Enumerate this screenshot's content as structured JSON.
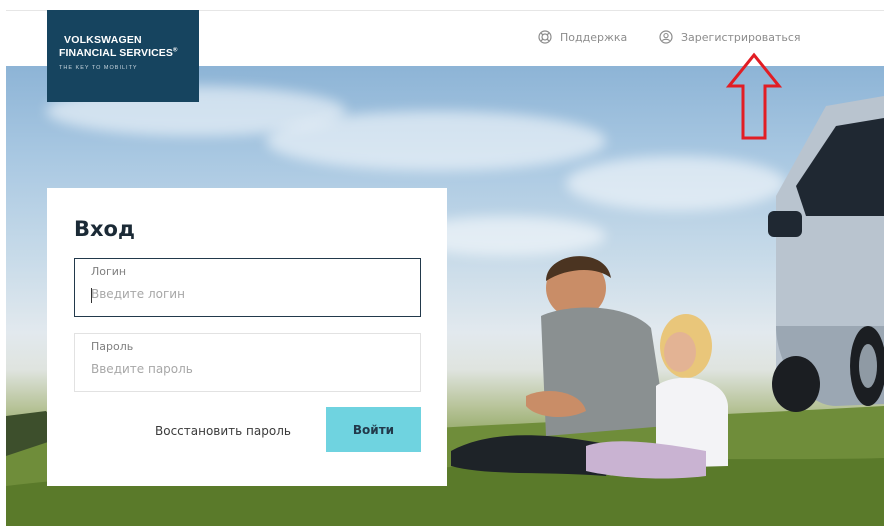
{
  "brand": {
    "line1": "VOLKSWAGEN",
    "line2": "FINANCIAL SERVICES",
    "registered_mark": "®",
    "tagline": "THE KEY TO MOBILITY"
  },
  "nav": {
    "support_label": "Поддержка",
    "register_label": "Зарегистрироваться"
  },
  "login": {
    "title": "Вход",
    "login_label": "Логин",
    "login_placeholder": "Введите логин",
    "login_value": "",
    "password_label": "Пароль",
    "password_placeholder": "Введите пароль",
    "password_value": "",
    "restore_link": "Восстановить пароль",
    "submit_label": "Войти"
  },
  "colors": {
    "brand_blue": "#16445f",
    "accent_cyan": "#6fd3e0",
    "annotation_red": "#e21d24"
  }
}
